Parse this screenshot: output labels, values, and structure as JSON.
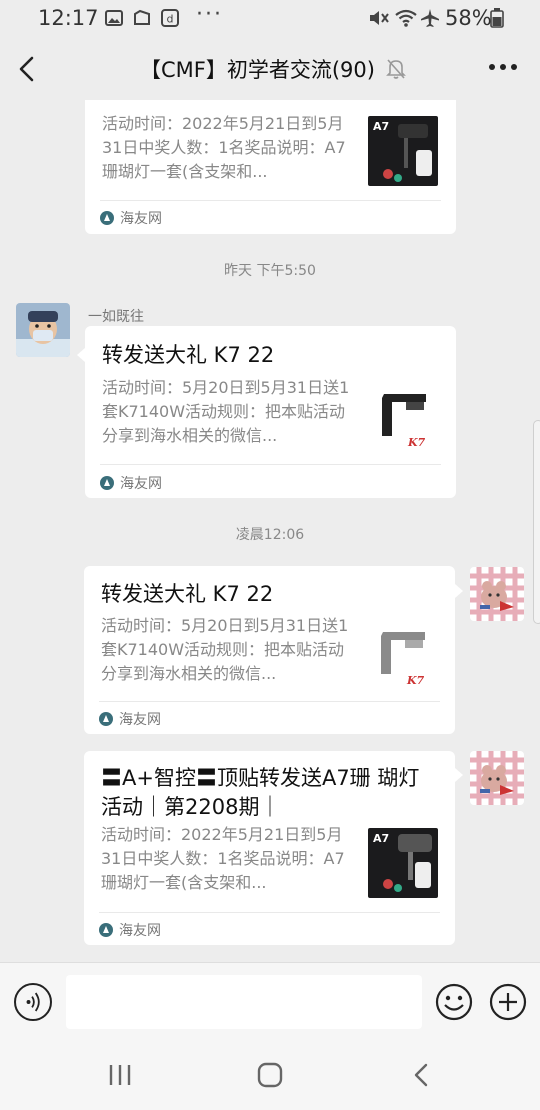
{
  "status_bar": {
    "time": "12:17",
    "battery_percent": "58%",
    "dots": "···",
    "icons": [
      "image-icon",
      "folder-icon",
      "app-icon",
      "mute-vibrate-icon",
      "wifi-icon",
      "airplane-icon",
      "battery-icon"
    ]
  },
  "title_bar": {
    "title": "【CMF】初学者交流(90)",
    "more": "···",
    "icons": [
      "back-arrow-icon",
      "notification-muted-icon",
      "more-icon"
    ]
  },
  "messages": [
    {
      "type": "link_card_partial",
      "side": "left",
      "desc": "活动时间：2022年5月21日到5月31日中奖人数：1名奖品说明：A7珊瑚灯一套(含支架和...",
      "source": "海友网",
      "thumb_label": "A7"
    },
    {
      "type": "timestamp",
      "text": "昨天 下午5:50"
    },
    {
      "type": "link_card",
      "side": "left",
      "sender": "一如既往",
      "title": "转发送大礼 K7 22",
      "desc": "活动时间：5月20日到5月31日送1套K7140W活动规则：把本贴活动分享到海水相关的微信...",
      "source": "海友网",
      "thumb_label": "K7"
    },
    {
      "type": "timestamp",
      "text": "凌晨12:06"
    },
    {
      "type": "link_card",
      "side": "right",
      "title": "转发送大礼 K7 22",
      "desc": "活动时间：5月20日到5月31日送1套K7140W活动规则：把本贴活动分享到海水相关的微信...",
      "source": "海友网",
      "thumb_label": "K7"
    },
    {
      "type": "link_card",
      "side": "right",
      "title": "〓A+智控〓顶贴转发送A7珊 瑚灯活动｜第2208期｜",
      "desc": "活动时间：2022年5月21日到5月31日中奖人数：1名奖品说明：A7珊瑚灯一套(含支架和...",
      "source": "海友网",
      "thumb_label": "A7"
    }
  ],
  "input_bar": {
    "placeholder": "",
    "value": "",
    "icons": [
      "voice-icon",
      "emoji-icon",
      "plus-icon"
    ]
  },
  "nav_bar": {
    "icons": [
      "recent-apps-icon",
      "home-icon",
      "back-icon"
    ]
  },
  "colors": {
    "background": "#ededed",
    "bubble": "#ffffff",
    "text_primary": "#111111",
    "text_secondary": "#888888",
    "source_icon": "#3a6e7a"
  }
}
